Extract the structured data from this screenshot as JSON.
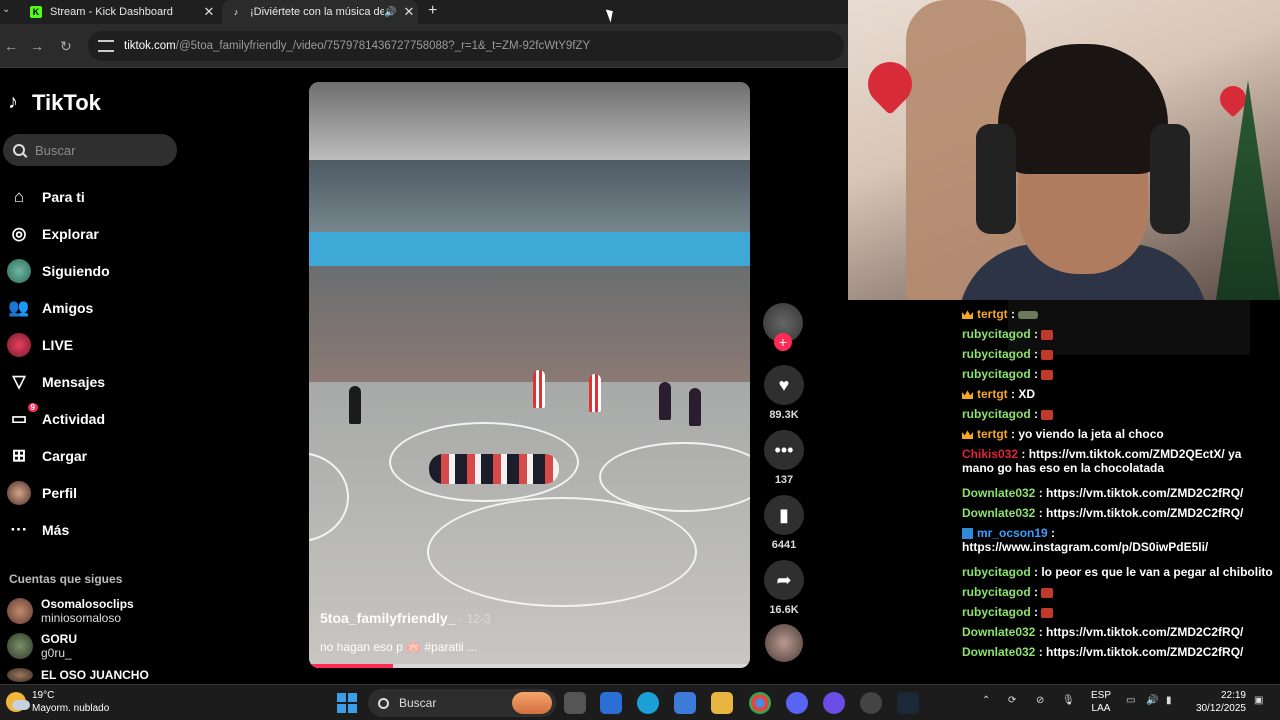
{
  "browser": {
    "tabs": [
      {
        "title": "Stream - Kick Dashboard",
        "favicon": "kick-icon",
        "color": "#53fc18"
      },
      {
        "title": "¡Diviértete con la música de",
        "favicon": "tiktok-icon",
        "color": "#ffffff"
      }
    ],
    "url_host": "tiktok.com",
    "url_path": "/@5toa_familyfriendly_/video/7579781436727758088?_r=1&_t=ZM-92fcWtY9fZY"
  },
  "tiktok": {
    "logo": "TikTok",
    "search_placeholder": "Buscar",
    "menu": [
      {
        "label": "Para ti",
        "icon": "home-icon"
      },
      {
        "label": "Explorar",
        "icon": "compass-icon"
      },
      {
        "label": "Siguiendo",
        "icon": "following-avatar-icon"
      },
      {
        "label": "Amigos",
        "icon": "friends-icon"
      },
      {
        "label": "LIVE",
        "icon": "live-icon"
      },
      {
        "label": "Mensajes",
        "icon": "messages-icon"
      },
      {
        "label": "Actividad",
        "icon": "activity-icon",
        "badge": "9"
      },
      {
        "label": "Cargar",
        "icon": "upload-icon"
      },
      {
        "label": "Perfil",
        "icon": "profile-avatar-icon"
      },
      {
        "label": "Más",
        "icon": "more-icon"
      }
    ],
    "following_header": "Cuentas que sigues",
    "following": [
      {
        "name": "Osomalosoclips",
        "handle": "miniosomaloso"
      },
      {
        "name": "GORU",
        "handle": "g0ru_"
      },
      {
        "name": "EL OSO JUANCHO",
        "handle": ""
      }
    ],
    "video": {
      "username": "5toa_familyfriendly_",
      "date": "· 12-3",
      "description": "no hagan eso p 🫁 #paratii ...",
      "progress": 0.19
    },
    "actions": {
      "likes": "89.3K",
      "comments": "137",
      "saves": "6441",
      "shares": "16.6K"
    }
  },
  "chat": [
    {
      "user": "tertgt",
      "color": "#f5a623",
      "badge": "crown",
      "text": "",
      "emote": "tank"
    },
    {
      "user": "rubycitagod",
      "color": "#8be36b",
      "badge": "",
      "text": "",
      "emote": "red"
    },
    {
      "user": "rubycitagod",
      "color": "#8be36b",
      "badge": "",
      "text": "",
      "emote": "red"
    },
    {
      "user": "rubycitagod",
      "color": "#8be36b",
      "badge": "",
      "text": "",
      "emote": "red"
    },
    {
      "user": "tertgt",
      "color": "#f5a623",
      "badge": "crown",
      "text": "XD",
      "emote": ""
    },
    {
      "user": "rubycitagod",
      "color": "#8be36b",
      "badge": "",
      "text": "",
      "emote": "red"
    },
    {
      "user": "tertgt",
      "color": "#f5a623",
      "badge": "crown",
      "text": "yo viendo la jeta al choco",
      "emote": ""
    },
    {
      "user": "Chikis032",
      "color": "#e0223a",
      "badge": "",
      "text": "https://vm.tiktok.com/ZMD2QEctX/ ya mano go has eso en la chocolatada",
      "emote": ""
    },
    {
      "user": "Downlate032",
      "color": "#8be36b",
      "badge": "",
      "text": "https://vm.tiktok.com/ZMD2C2fRQ/",
      "emote": ""
    },
    {
      "user": "Downlate032",
      "color": "#8be36b",
      "badge": "",
      "text": "https://vm.tiktok.com/ZMD2C2fRQ/",
      "emote": ""
    },
    {
      "user": "mr_ocson19",
      "color": "#3aa0ff",
      "badge": "mod",
      "text": "https://www.instagram.com/p/DS0iwPdE5li/",
      "emote": ""
    },
    {
      "user": "rubycitagod",
      "color": "#8be36b",
      "badge": "",
      "text": "lo peor es que le van a pegar al chibolito",
      "emote": ""
    },
    {
      "user": "rubycitagod",
      "color": "#8be36b",
      "badge": "",
      "text": "",
      "emote": "red"
    },
    {
      "user": "rubycitagod",
      "color": "#8be36b",
      "badge": "",
      "text": "",
      "emote": "red"
    },
    {
      "user": "Downlate032",
      "color": "#8be36b",
      "badge": "",
      "text": "https://vm.tiktok.com/ZMD2C2fRQ/",
      "emote": ""
    },
    {
      "user": "Downlate032",
      "color": "#8be36b",
      "badge": "",
      "text": "https://vm.tiktok.com/ZMD2C2fRQ/",
      "emote": ""
    }
  ],
  "taskbar": {
    "temp": "19°C",
    "weather": "Mayorm. nublado",
    "search": "Buscar",
    "lang1": "ESP",
    "lang2": "LAA",
    "time": "22:19",
    "date": "30/12/2025"
  }
}
